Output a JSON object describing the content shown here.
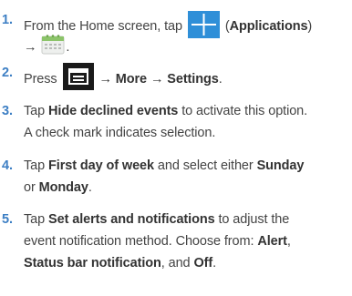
{
  "steps": [
    {
      "number": "1.",
      "line1": {
        "t1": "From the Home screen, tap",
        "t2": "(",
        "b1": "Applications",
        "t3": ")"
      },
      "line2": {
        "arrow": "→",
        "t1": "."
      }
    },
    {
      "number": "2.",
      "line1": {
        "t1": "Press",
        "b1": "→ More → Settings",
        "t2": "."
      }
    },
    {
      "number": "3.",
      "line1": {
        "t1": "Tap",
        "b1": "Hide declined events",
        "t2": "to activate this option."
      },
      "line2": {
        "t1": "A check mark indicates selection."
      }
    },
    {
      "number": "4.",
      "line1": {
        "t1": "Tap",
        "b1": "First day of week",
        "t2": "and select either",
        "b2": "Sunday"
      },
      "line2": {
        "t1": "or",
        "b1": "Monday",
        "t2": "."
      }
    },
    {
      "number": "5.",
      "line1": {
        "t1": "Tap",
        "b1": "Set alerts and notifications",
        "t2": "to adjust the"
      },
      "line2": {
        "t1": "event notification method. Choose from:",
        "b1": "Alert",
        "t2": ","
      },
      "line3": {
        "b1": "Status bar notification",
        "t1": ", and",
        "b2": "Off",
        "t2": "."
      }
    }
  ],
  "icons": {
    "applications": "applications-grid-icon",
    "menu": "menu-key-icon",
    "calendar": "calendar-app-icon"
  }
}
